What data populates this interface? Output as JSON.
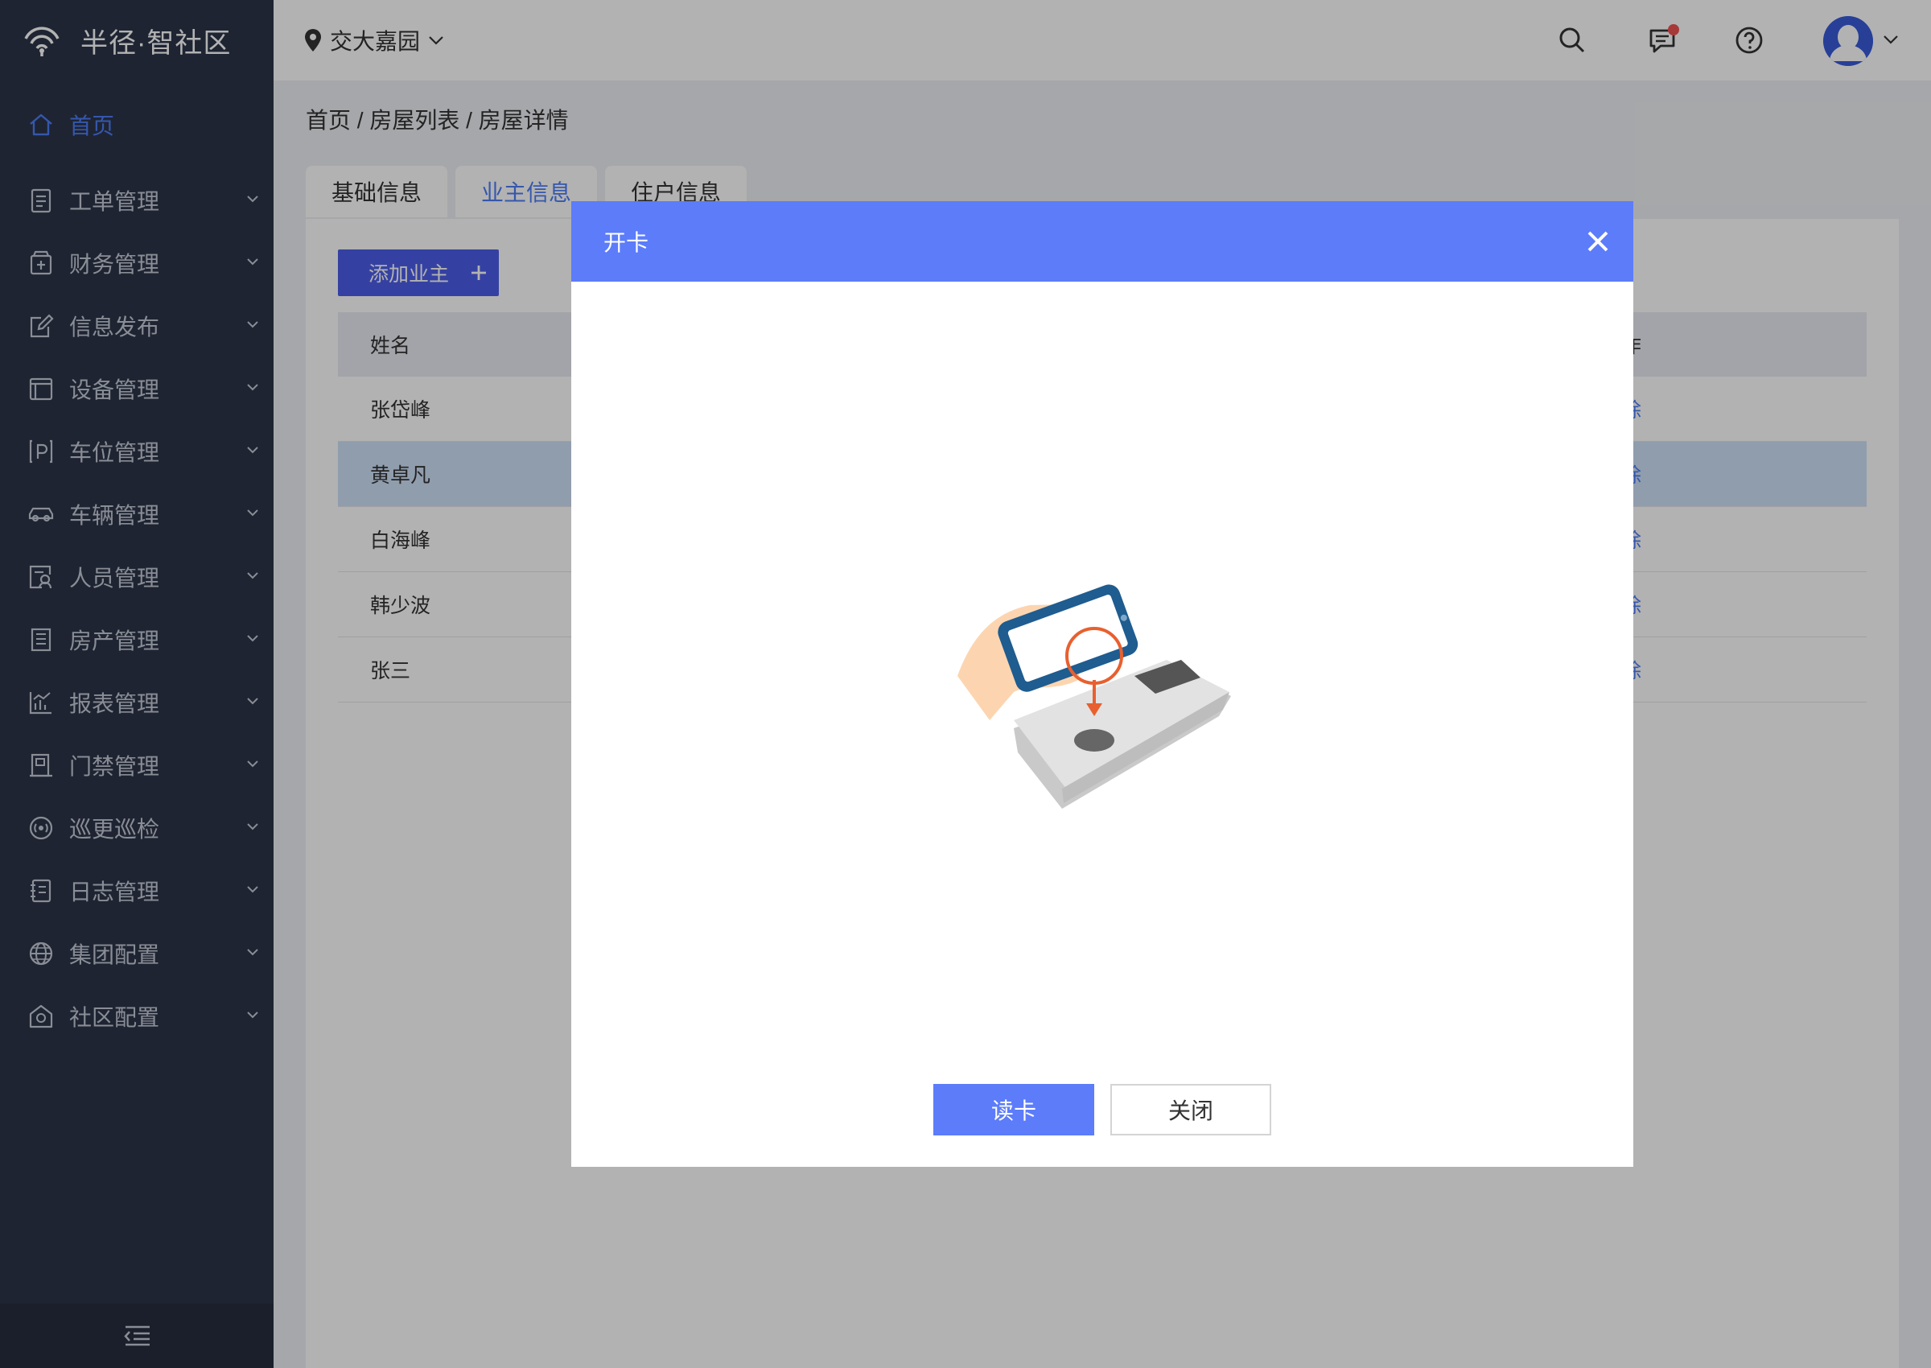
{
  "brand": {
    "name": "半径·智社区"
  },
  "header": {
    "community": "交大嘉园"
  },
  "sidebar": {
    "items": [
      {
        "label": "首页",
        "icon": "home-icon"
      },
      {
        "label": "工单管理",
        "icon": "clipboard-icon"
      },
      {
        "label": "财务管理",
        "icon": "wallet-icon"
      },
      {
        "label": "信息发布",
        "icon": "edit-icon"
      },
      {
        "label": "设备管理",
        "icon": "device-icon"
      },
      {
        "label": "车位管理",
        "icon": "parking-icon"
      },
      {
        "label": "车辆管理",
        "icon": "car-icon"
      },
      {
        "label": "人员管理",
        "icon": "person-card-icon"
      },
      {
        "label": "房产管理",
        "icon": "building-icon"
      },
      {
        "label": "报表管理",
        "icon": "chart-icon"
      },
      {
        "label": "门禁管理",
        "icon": "door-icon"
      },
      {
        "label": "巡更巡检",
        "icon": "patrol-icon"
      },
      {
        "label": "日志管理",
        "icon": "log-icon"
      },
      {
        "label": "集团配置",
        "icon": "globe-icon"
      },
      {
        "label": "社区配置",
        "icon": "community-icon"
      }
    ]
  },
  "breadcrumb": "首页 /  房屋列表 / 房屋详情",
  "tabs": [
    {
      "label": "基础信息"
    },
    {
      "label": "业主信息"
    },
    {
      "label": "住户信息"
    }
  ],
  "owner_panel": {
    "add_label": "添加业主",
    "columns": {
      "name": "姓名",
      "ops": "操作"
    },
    "rows": [
      {
        "name": "张岱峰",
        "op": "删除"
      },
      {
        "name": "黄卓凡",
        "op": "删除"
      },
      {
        "name": "白海峰",
        "op": "删除"
      },
      {
        "name": "韩少波",
        "op": "删除"
      },
      {
        "name": "张三",
        "op": "删除"
      }
    ]
  },
  "modal": {
    "title": "开卡",
    "read_button": "读卡",
    "close_button": "关闭"
  },
  "colors": {
    "accent": "#5c7cfa",
    "sidebar_bg": "#2c3448",
    "selected_row": "#cfe1f8",
    "notification_dot": "#f05252"
  }
}
